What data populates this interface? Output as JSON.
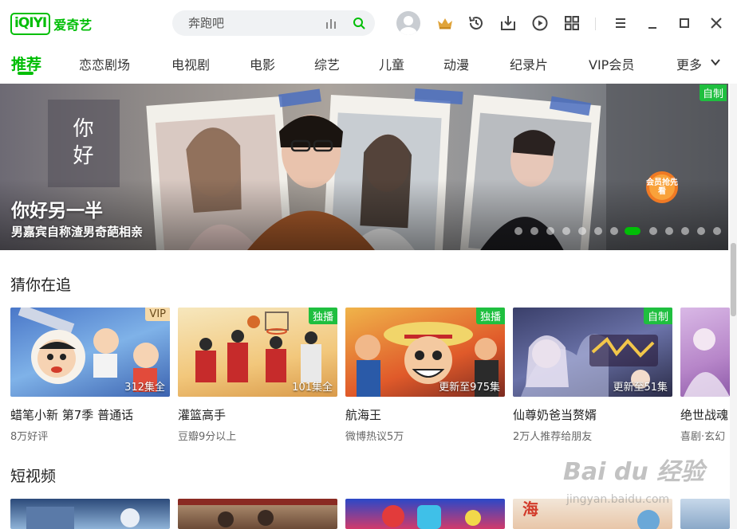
{
  "app": {
    "logo_text": "iQIYI",
    "logo_cn": "爱奇艺"
  },
  "search": {
    "placeholder": "奔跑吧"
  },
  "nav": {
    "items": [
      {
        "label": "推荐"
      },
      {
        "label": "恋恋剧场"
      },
      {
        "label": "电视剧"
      },
      {
        "label": "电影"
      },
      {
        "label": "综艺"
      },
      {
        "label": "儿童"
      },
      {
        "label": "动漫"
      },
      {
        "label": "纪录片"
      },
      {
        "label": "VIP会员"
      },
      {
        "label": "更多"
      }
    ],
    "active_index": 0
  },
  "banner": {
    "title": "你好另一半",
    "subtitle": "男嘉宾自称渣男奇葩相亲",
    "badge": "自制",
    "poster_text": "你好",
    "sticker_text": "会员抢先看",
    "dot_count": 13,
    "active_dot": 7
  },
  "section_follow": {
    "title": "猜你在追",
    "cards": [
      {
        "title": "蜡笔小新 第7季 普通话",
        "sub": "8万好评",
        "tag": "VIP",
        "count": "312集全"
      },
      {
        "title": "灌篮高手",
        "sub": "豆瓣9分以上",
        "tag": "独播",
        "count": "101集全"
      },
      {
        "title": "航海王",
        "sub": "微博热议5万",
        "tag": "独播",
        "count": "更新至975集"
      },
      {
        "title": "仙尊奶爸当赘婿",
        "sub": "2万人推荐给朋友",
        "tag": "自制",
        "count": "更新至51集"
      },
      {
        "title": "绝世战魂",
        "sub": "喜剧·玄幻",
        "tag": "",
        "count": ""
      }
    ]
  },
  "section_short": {
    "title": "短视频"
  },
  "watermark": {
    "big": "Bai du 经验",
    "small": "jingyan.baidu.com"
  },
  "colors": {
    "brand": "#00be06",
    "tag_green": "#1fbf3f"
  }
}
